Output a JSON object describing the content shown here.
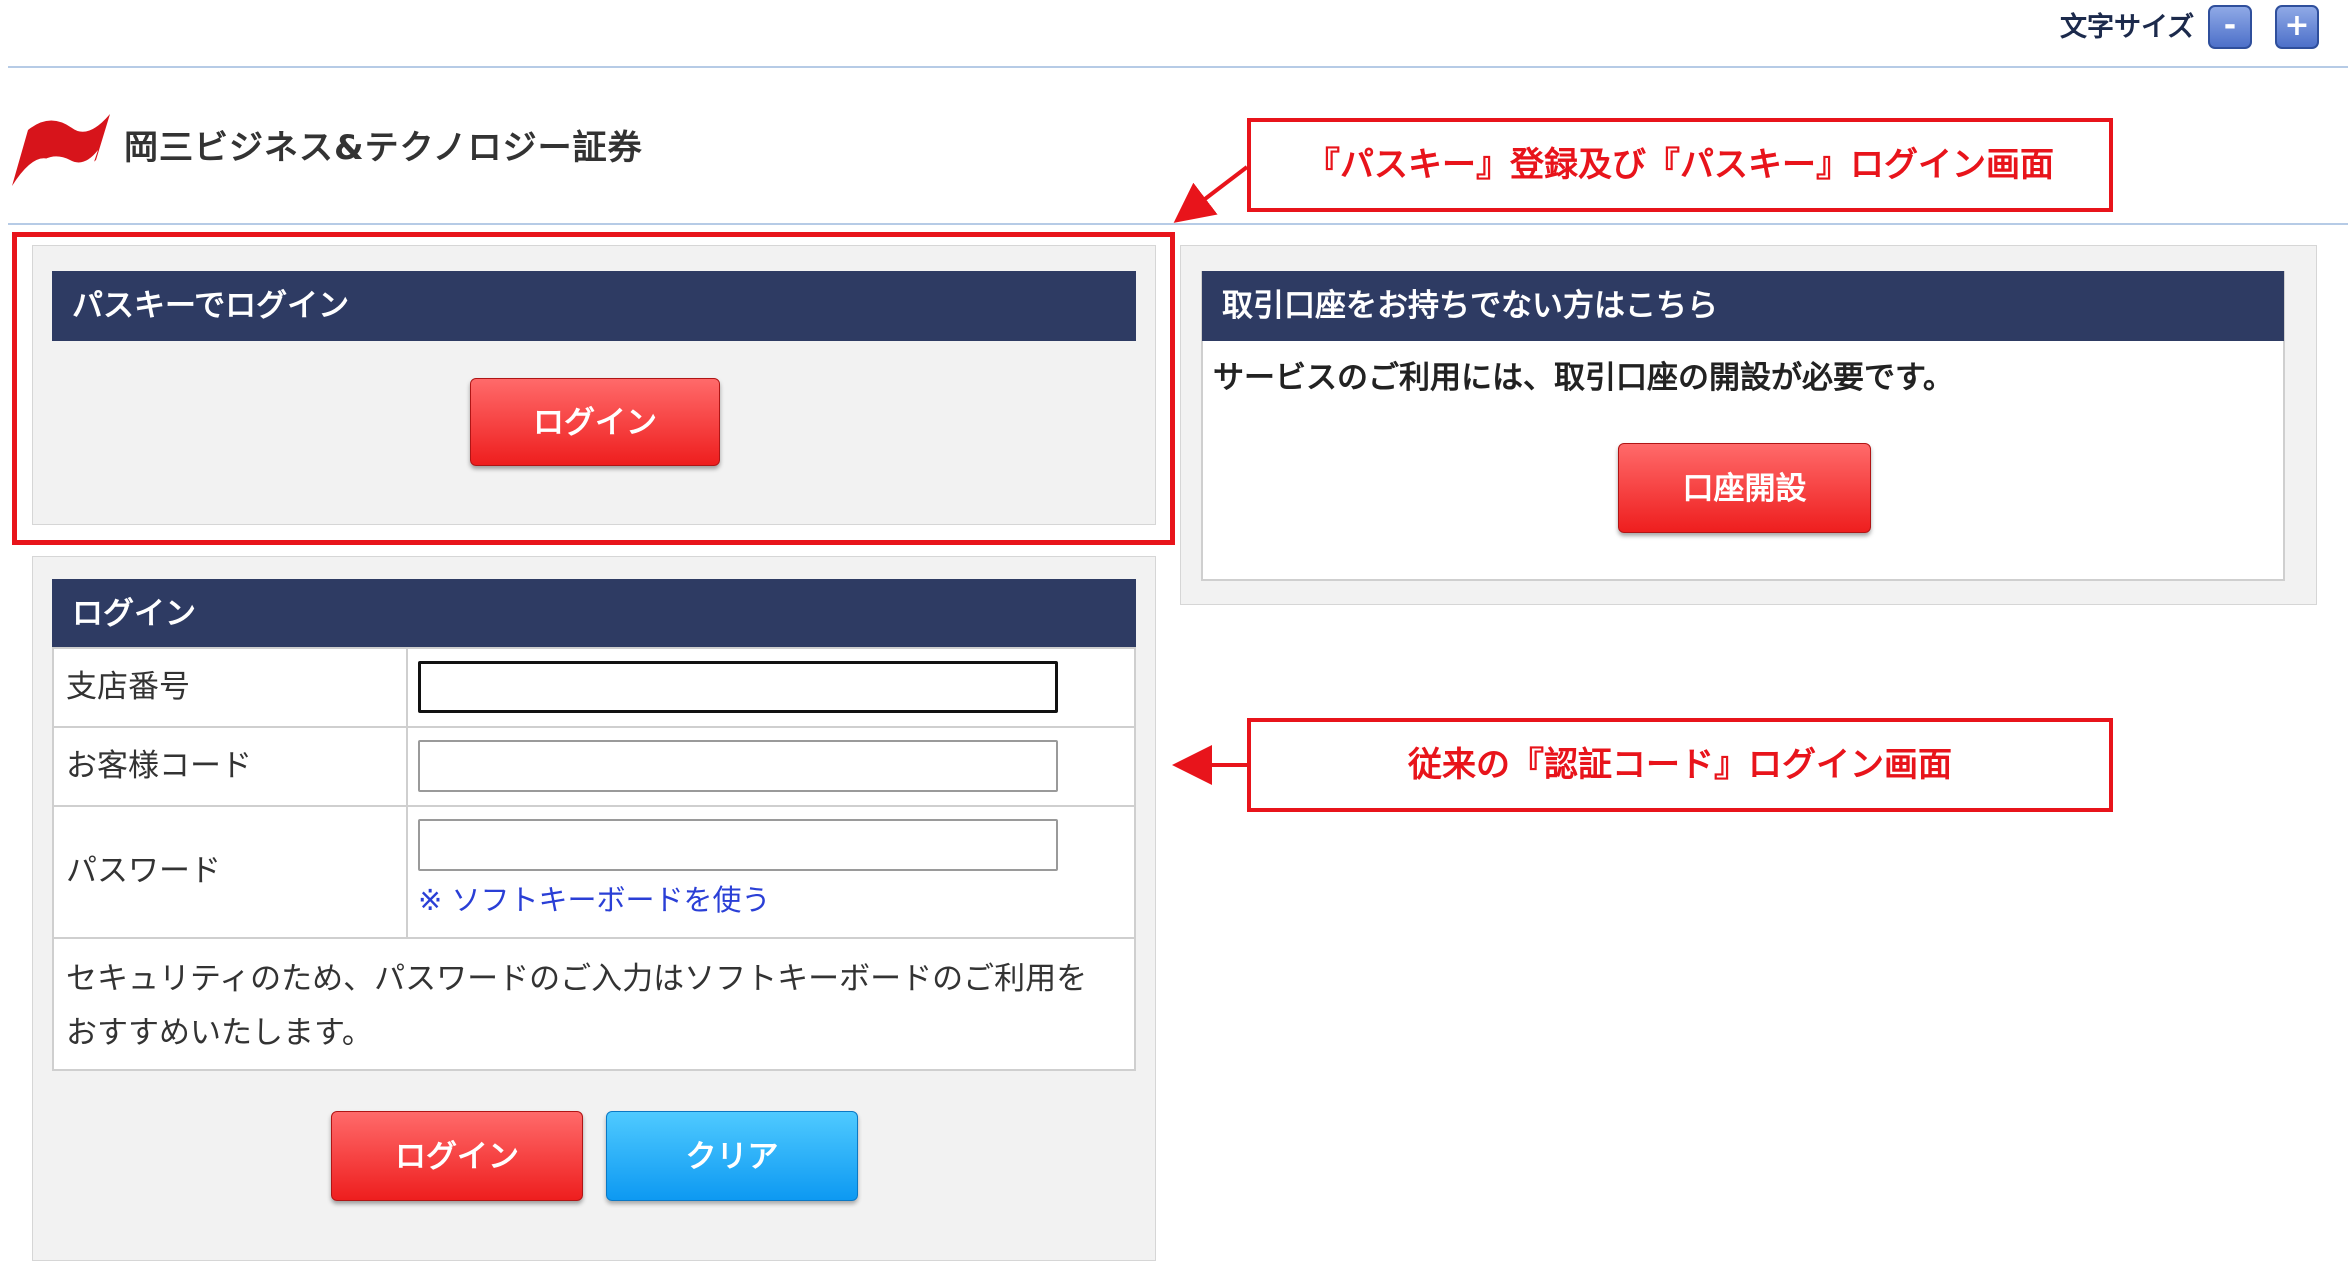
{
  "toolbar": {
    "font_size_label": "文字サイズ",
    "decrease_label": "-",
    "increase_label": "+"
  },
  "brand": {
    "name": "岡三ビジネス&テクノロジー証券",
    "logo_color": "#d7141b"
  },
  "passkey_panel": {
    "title": "パスキーでログイン",
    "login_button": "ログイン"
  },
  "account_panel": {
    "title": "取引口座をお持ちでない方はこちら",
    "description": "サービスのご利用には、取引口座の開設が必要です。",
    "open_button": "口座開設"
  },
  "login_panel": {
    "title": "ログイン",
    "fields": [
      {
        "label": "支店番号",
        "value": "",
        "placeholder": ""
      },
      {
        "label": "お客様コード",
        "value": "",
        "placeholder": ""
      },
      {
        "label": "パスワード",
        "value": "",
        "placeholder": ""
      }
    ],
    "soft_keyboard_link": "※ ソフトキーボードを使う",
    "notice_line1": "セキュリティのため、パスワードのご入力はソフトキーボードのご利用を",
    "notice_line2": "おすすめいたします。",
    "login_button": "ログイン",
    "clear_button": "クリア"
  },
  "annotations": {
    "passkey_note": "『パスキー』登録及び『パスキー』ログイン画面",
    "legacy_note": "従来の『認証コード』ログイン画面",
    "color": "#e8141b"
  },
  "colors": {
    "header_navy": "#2e3b63",
    "button_red": "#ee1e1e",
    "button_blue": "#0d99f2"
  }
}
